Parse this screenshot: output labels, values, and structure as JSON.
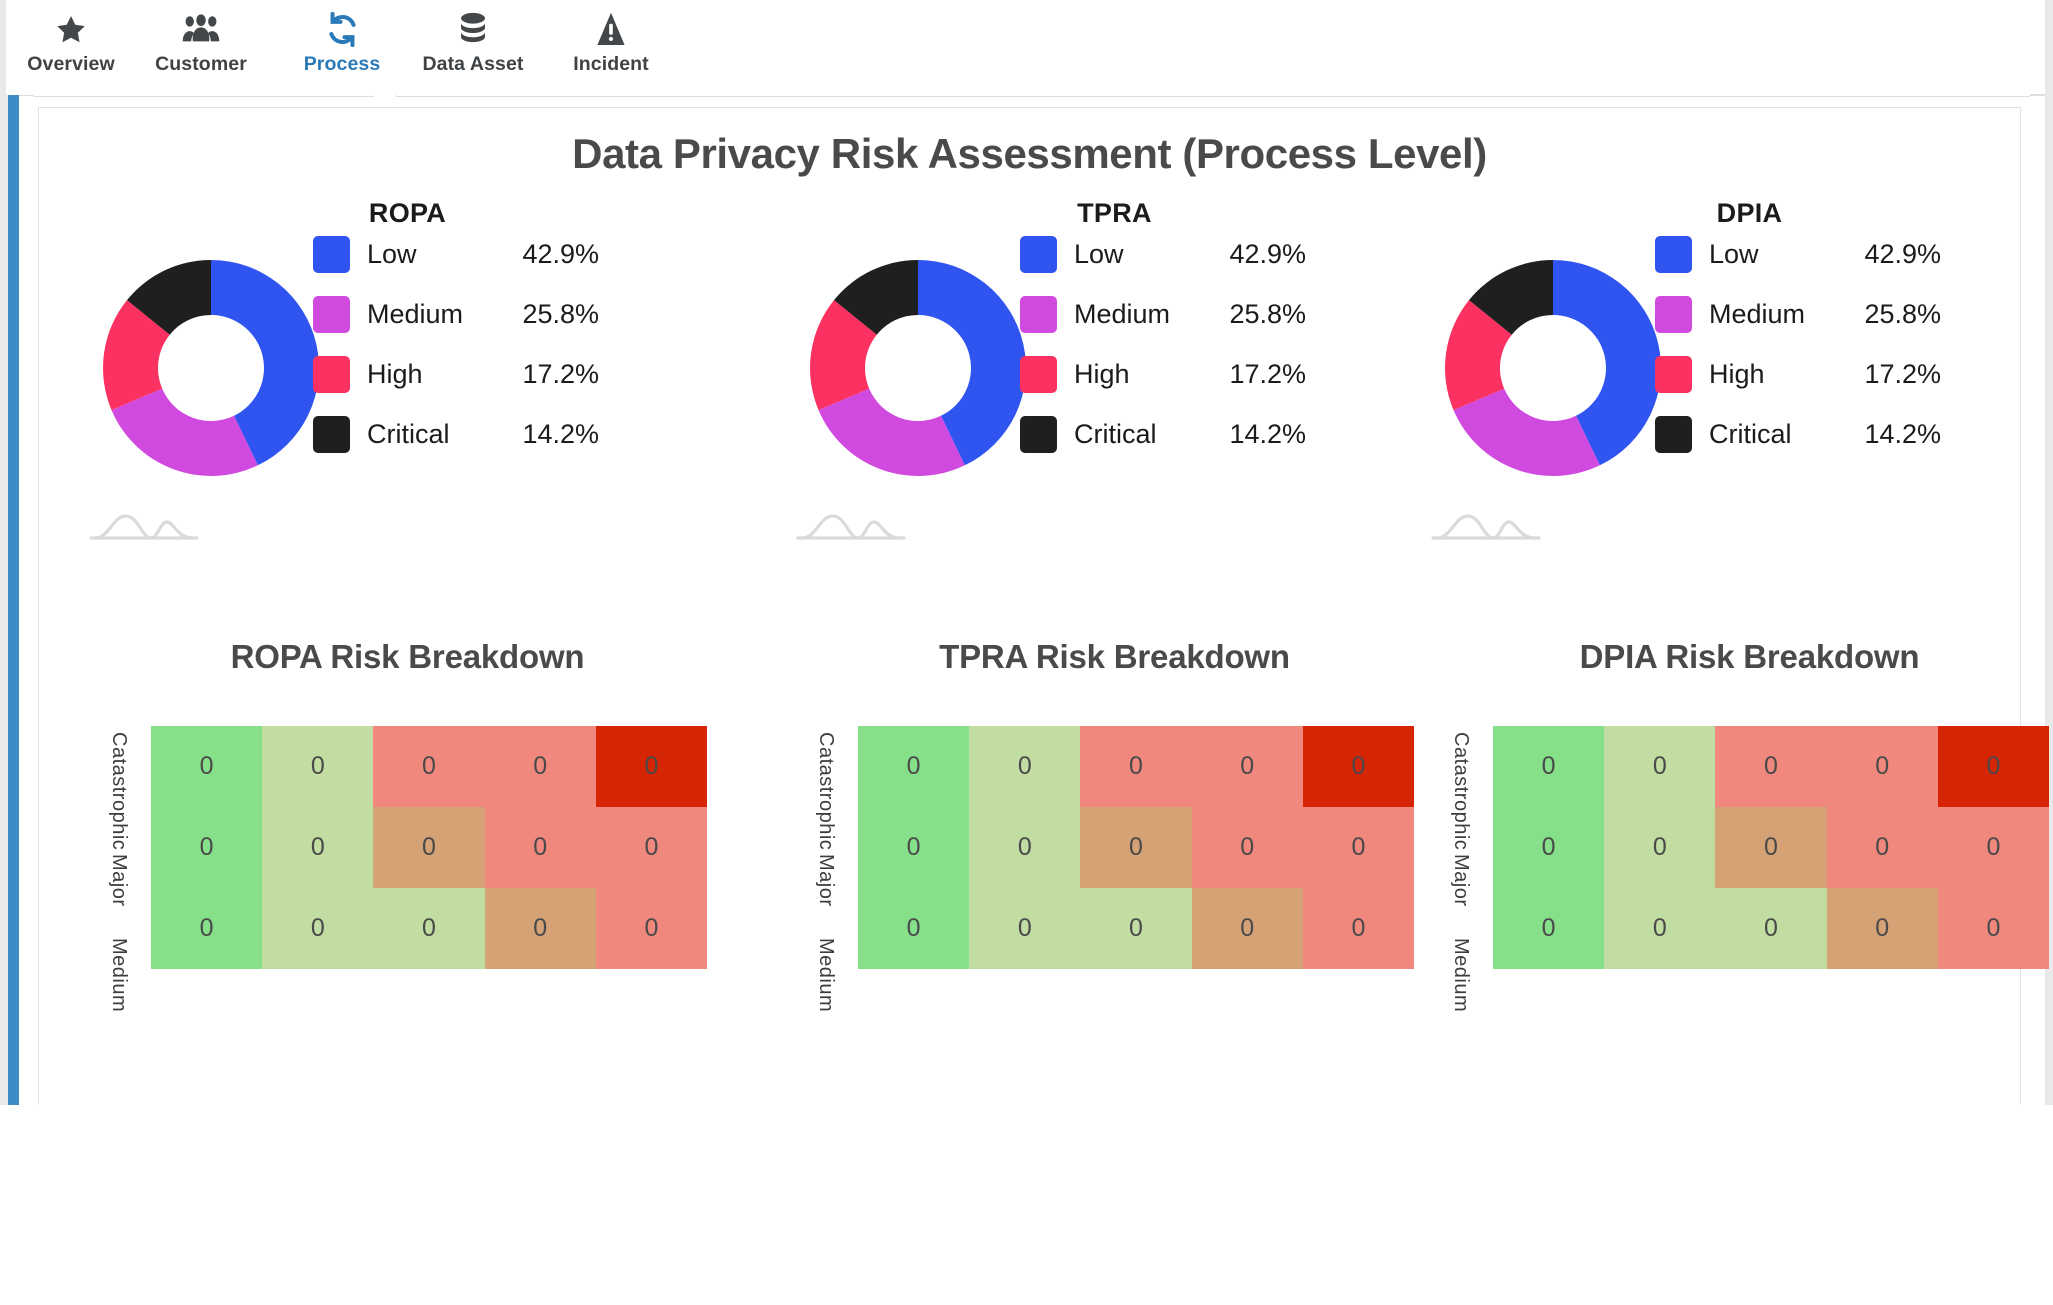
{
  "accent_color": "#2b7ab8",
  "rail_color": "#3b8cc4",
  "tabs": [
    {
      "label": "Overview",
      "icon": "star-icon",
      "active": false
    },
    {
      "label": "Customer",
      "icon": "people-icon",
      "active": false
    },
    {
      "label": "Process",
      "icon": "refresh-icon",
      "active": true
    },
    {
      "label": "Data Asset",
      "icon": "database-icon",
      "active": false
    },
    {
      "label": "Incident",
      "icon": "warning-icon",
      "active": false
    }
  ],
  "main": {
    "title": "Data Privacy Risk Assessment (Process Level)"
  },
  "chart_data": [
    {
      "type": "pie",
      "title": "ROPA",
      "subtype": "donut",
      "categories": [
        "Low",
        "Medium",
        "High",
        "Critical"
      ],
      "values": [
        42.9,
        25.8,
        17.2,
        14.2
      ],
      "value_labels": [
        "42.9%",
        "25.8%",
        "17.2%",
        "14.2%"
      ],
      "colors": [
        "#2f54f0",
        "#d council",
        "#fb3261",
        "#1f1f1f"
      ],
      "legend_position": "right",
      "units": "percent"
    },
    {
      "type": "pie",
      "title": "TPRA",
      "subtype": "donut",
      "categories": [
        "Low",
        "Medium",
        "High",
        "Critical"
      ],
      "values": [
        42.9,
        25.8,
        17.2,
        14.2
      ],
      "value_labels": [
        "42.9%",
        "25.8%",
        "17.2%",
        "14.2%"
      ],
      "legend_position": "right",
      "units": "percent"
    },
    {
      "type": "pie",
      "title": "DPIA",
      "subtype": "donut",
      "categories": [
        "Low",
        "Medium",
        "High",
        "Critical"
      ],
      "values": [
        42.9,
        25.8,
        17.2,
        14.2
      ],
      "value_labels": [
        "42.9%",
        "25.8%",
        "17.2%",
        "14.2%"
      ],
      "legend_position": "right",
      "units": "percent"
    },
    {
      "type": "heatmap",
      "title": "ROPA Risk Breakdown",
      "ylabels": [
        "Catastrophic",
        "Major",
        "Medium"
      ],
      "rows": [
        [
          "0",
          "0",
          "0",
          "0",
          "0"
        ],
        [
          "0",
          "0",
          "0",
          "0",
          "0"
        ],
        [
          "0",
          "0",
          "0",
          "0",
          "0"
        ]
      ],
      "cell_colors": [
        [
          "#86e08a",
          "#c2dda2",
          "#f0887d",
          "#f0887d",
          "#d52505"
        ],
        [
          "#86e08a",
          "#c2dda2",
          "#d5a276",
          "#f0887d",
          "#f0887d"
        ],
        [
          "#86e08a",
          "#c2dda2",
          "#c2dda2",
          "#d5a276",
          "#f0887d"
        ]
      ],
      "grid": false
    },
    {
      "type": "heatmap",
      "title": "TPRA Risk Breakdown",
      "ylabels": [
        "Catastrophic",
        "Major",
        "Medium"
      ],
      "rows": [
        [
          "0",
          "0",
          "0",
          "0",
          "0"
        ],
        [
          "0",
          "0",
          "0",
          "0",
          "0"
        ],
        [
          "0",
          "0",
          "0",
          "0",
          "0"
        ]
      ],
      "grid": false
    },
    {
      "type": "heatmap",
      "title": "DPIA Risk Breakdown",
      "ylabels": [
        "Catastrophic",
        "Major",
        "Medium"
      ],
      "rows": [
        [
          "0",
          "0",
          "0",
          "0",
          "0"
        ],
        [
          "0",
          "0",
          "0",
          "0",
          "0"
        ],
        [
          "0",
          "0",
          "0",
          "0",
          "0"
        ]
      ],
      "grid": false
    }
  ],
  "palette": {
    "low": "#2f54f0",
    "medium": "#d14ae0",
    "high": "#fb3261",
    "critical": "#1f1f1f",
    "heat_green": "#86e08a",
    "heat_lightgreen": "#c2dda2",
    "heat_tan": "#d5a276",
    "heat_salmon": "#f0887d",
    "heat_red": "#d52505"
  },
  "donuts": [
    {
      "title": "ROPA",
      "legend": [
        {
          "label": "Low",
          "value": "42.9%",
          "color": "#2f54f0"
        },
        {
          "label": "Medium",
          "value": "25.8%",
          "color": "#d14ae0"
        },
        {
          "label": "High",
          "value": "17.2%",
          "color": "#fb3261"
        },
        {
          "label": "Critical",
          "value": "14.2%",
          "color": "#1f1f1f"
        }
      ]
    },
    {
      "title": "TPRA",
      "legend": [
        {
          "label": "Low",
          "value": "42.9%",
          "color": "#2f54f0"
        },
        {
          "label": "Medium",
          "value": "25.8%",
          "color": "#d14ae0"
        },
        {
          "label": "High",
          "value": "17.2%",
          "color": "#fb3261"
        },
        {
          "label": "Critical",
          "value": "14.2%",
          "color": "#1f1f1f"
        }
      ]
    },
    {
      "title": "DPIA",
      "legend": [
        {
          "label": "Low",
          "value": "42.9%",
          "color": "#2f54f0"
        },
        {
          "label": "Medium",
          "value": "25.8%",
          "color": "#d14ae0"
        },
        {
          "label": "High",
          "value": "17.2%",
          "color": "#fb3261"
        },
        {
          "label": "Critical",
          "value": "14.2%",
          "color": "#1f1f1f"
        }
      ]
    }
  ],
  "heatmaps": [
    {
      "title": "ROPA Risk Breakdown",
      "ylabels": [
        "Catastrophic",
        "Major",
        "Medium"
      ]
    },
    {
      "title": "TPRA Risk Breakdown",
      "ylabels": [
        "Catastrophic",
        "Major",
        "Medium"
      ]
    },
    {
      "title": "DPIA Risk Breakdown",
      "ylabels": [
        "Catastrophic",
        "Major",
        "Medium"
      ]
    }
  ]
}
